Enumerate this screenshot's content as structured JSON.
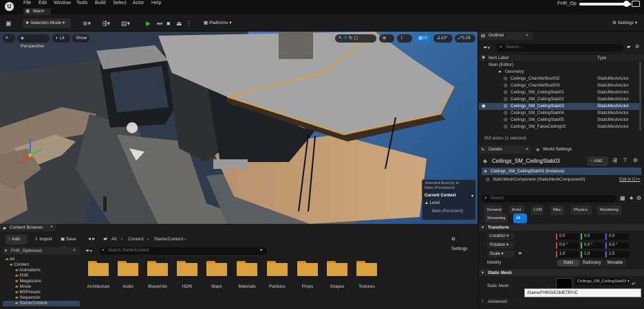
{
  "menubar": {
    "items": [
      "File",
      "Edit",
      "Window",
      "Tools",
      "Build",
      "Select",
      "Actor",
      "Help"
    ],
    "project": "FHR_Op"
  },
  "document_tab": {
    "label": "Main•"
  },
  "toolbar": {
    "selection_mode": "Selection Mode",
    "platforms": "Platforms",
    "settings": "Settings"
  },
  "viewport": {
    "perspective": "Perspective",
    "lit": "Lit",
    "show": "Show",
    "grid_snap": "10",
    "rotation_snap": "10°",
    "scale_snap": "0.25",
    "camera_speed": "4",
    "info": {
      "selected": "Selected Actor(s) in",
      "persistent": "Main (Persistent)",
      "current_context": "Current Context",
      "level_label": "Level",
      "level_value": "Main (Persistent)"
    }
  },
  "outliner": {
    "title": "Outliner",
    "search_placeholder": "Search...",
    "col_label": "Item Label",
    "col_type": "Type",
    "rows": [
      {
        "label": "Main (Editor)",
        "type": ""
      },
      {
        "label": "Geometry",
        "type": ""
      },
      {
        "label": "Ceilings_ChamferBox002",
        "type": "StaticMeshActor"
      },
      {
        "label": "Ceilings_ChamferBox003",
        "type": "StaticMeshActor"
      },
      {
        "label": "Ceilings_SM_CeilingSlab01",
        "type": "StaticMeshActor"
      },
      {
        "label": "Ceilings_SM_CeilingSlab02",
        "type": "StaticMeshActor"
      },
      {
        "label": "Ceilings_SM_CeilingSlab03",
        "type": "StaticMeshActor"
      },
      {
        "label": "Ceilings_SM_CeilingSlab04",
        "type": "StaticMeshActor"
      },
      {
        "label": "Ceilings_SM_CeilingSlab05",
        "type": "StaticMeshActor"
      },
      {
        "label": "Ceilings_SM_FalseCeiling02",
        "type": "StaticMeshActor"
      }
    ],
    "status": "853 actors (1 selected)"
  },
  "details": {
    "tab_details": "Details",
    "tab_world": "World Settings",
    "actor_name": "Ceilings_SM_CeilingSlab03",
    "add": "Add",
    "instance": "Ceilings_SM_CeilingSlab03 (Instance)",
    "component": "StaticMeshComponent (StaticMeshComponent0)",
    "edit_cpp": "Edit in C++",
    "search_placeholder": "Search",
    "filters": [
      "General",
      "Actor",
      "LOD",
      "Misc",
      "Physics",
      "Rendering",
      "Streaming",
      "All"
    ],
    "transform_title": "Transform",
    "location": "Location",
    "rotation": "Rotation",
    "scale": "Scale",
    "loc_vals": [
      "0.0",
      "0.0",
      "0.0"
    ],
    "rot_vals": [
      "0.0 °",
      "0.0 °",
      "0.0 °"
    ],
    "scale_vals": [
      "1.0",
      "1.0",
      "1.0"
    ],
    "mobility": "Mobility",
    "mobility_opts": [
      "Static",
      "Stationary",
      "Movable"
    ],
    "static_mesh_section": "Static Mesh",
    "static_mesh_label": "Static Mesh",
    "static_mesh_value": "Ceilings_SM_CeilingSlab03",
    "tooltip": "/Game/FHR/GEOMETRY/C",
    "advanced": "Advanced"
  },
  "content_browser": {
    "title": "Content Browser",
    "add": "Add",
    "import": "Import",
    "save_all": "Save All",
    "path": [
      "All",
      "Content",
      "StarterContent"
    ],
    "settings": "Settings",
    "project": "FHR_Optimized",
    "search_placeholder": "Search StarterContent",
    "tree": [
      "All",
      "Content",
      "Animations",
      "FHR",
      "Megascans",
      "Movie",
      "MSPresets",
      "Sequencer",
      "StarterContent"
    ],
    "folders": [
      "Architecture",
      "Audio",
      "Blueprints",
      "HDRI",
      "Maps",
      "Materials",
      "Particles",
      "Props",
      "Shapes",
      "Textures"
    ]
  },
  "colors": {
    "accent": "#0e7ad9",
    "play": "#35b335",
    "folder": "#d9a03c",
    "selected_row": "#32465f"
  }
}
